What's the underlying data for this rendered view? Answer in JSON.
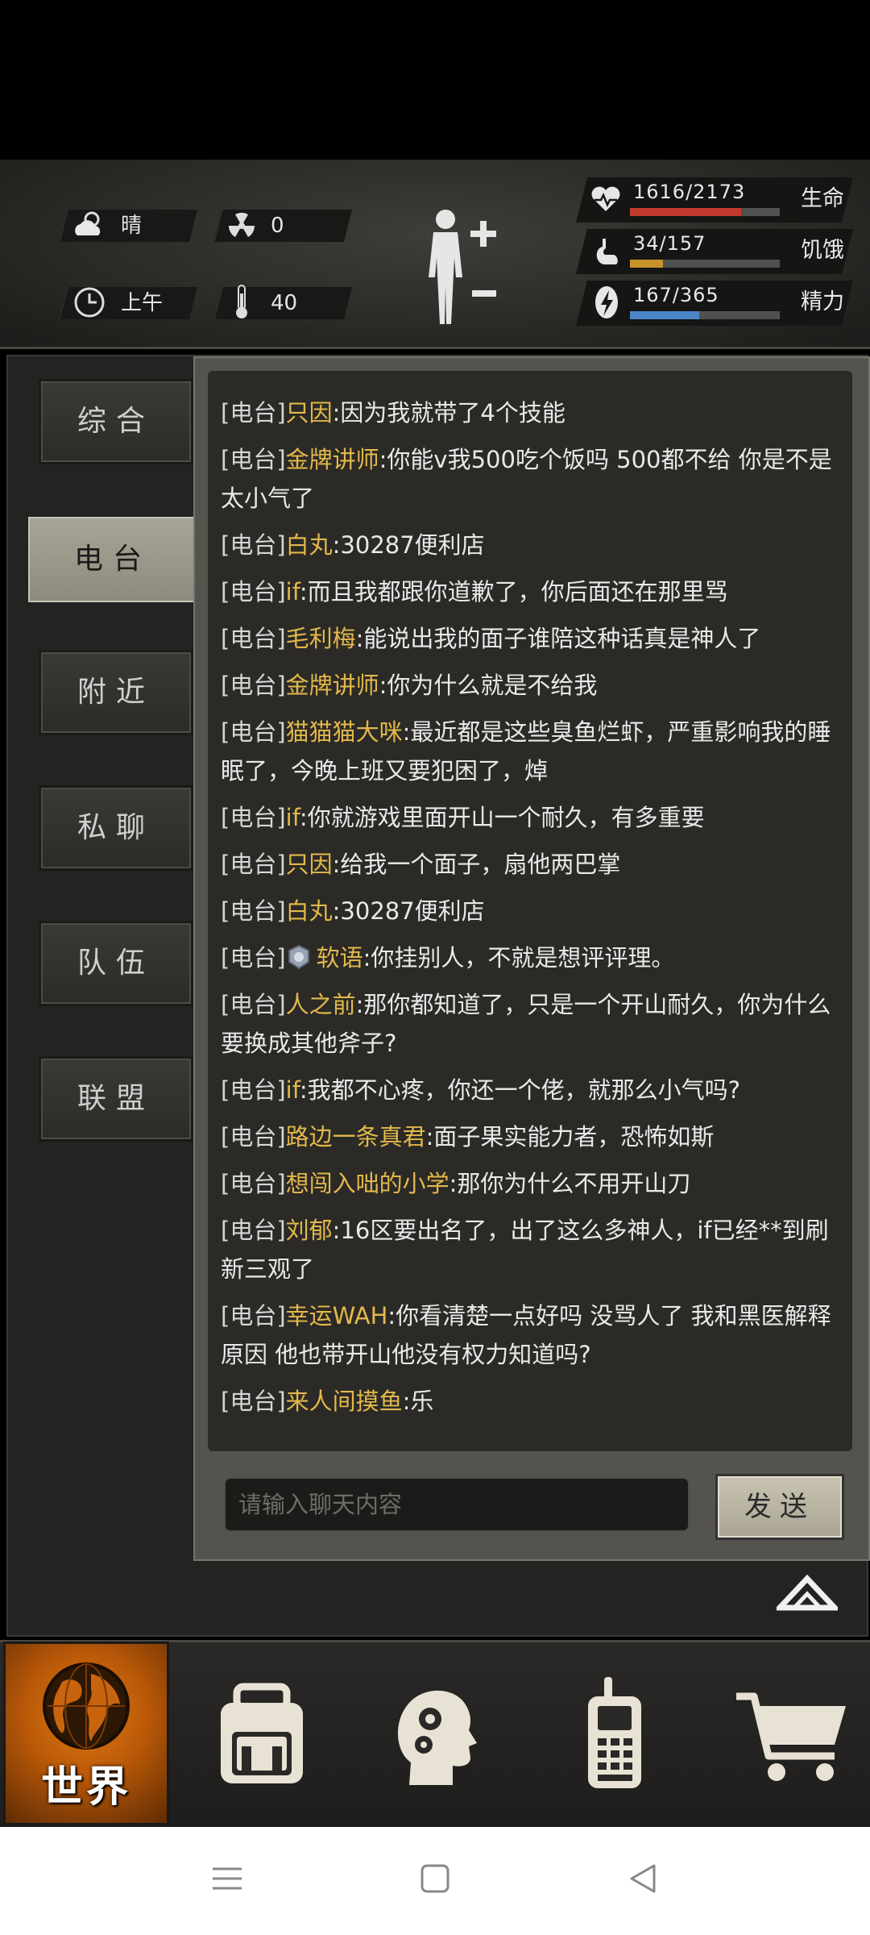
{
  "status": {
    "weather_label": "晴",
    "radiation_value": "0",
    "time_label": "上午",
    "temperature_value": "40"
  },
  "vitals": {
    "health": {
      "text": "1616/2173",
      "label": "生命",
      "fraction": 0.74,
      "color": "#c23a2e"
    },
    "hunger": {
      "text": "34/157",
      "label": "饥饿",
      "fraction": 0.22,
      "color": "#c9912a"
    },
    "energy": {
      "text": "167/365",
      "label": "精力",
      "fraction": 0.46,
      "color": "#4a86c8"
    }
  },
  "tabs": [
    {
      "label": "综合",
      "active": false
    },
    {
      "label": "电台",
      "active": true
    },
    {
      "label": "附近",
      "active": false
    },
    {
      "label": "私聊",
      "active": false
    },
    {
      "label": "队伍",
      "active": false
    },
    {
      "label": "联盟",
      "active": false
    }
  ],
  "messages": [
    {
      "channel": "[电台]",
      "user": "只因",
      "text": ":因为我就带了4个技能"
    },
    {
      "channel": "[电台]",
      "user": "金牌讲师",
      "text": ":你能v我500吃个饭吗 500都不给 你是不是太小气了"
    },
    {
      "channel": "[电台]",
      "user": "白丸",
      "text": ":30287便利店"
    },
    {
      "channel": "[电台]",
      "user": "if",
      "text": ":而且我都跟你道歉了，你后面还在那里骂"
    },
    {
      "channel": "[电台]",
      "user": "毛利梅",
      "text": ":能说出我的面子谁陪这种话真是神人了"
    },
    {
      "channel": "[电台]",
      "user": "金牌讲师",
      "text": ":你为什么就是不给我"
    },
    {
      "channel": "[电台]",
      "user": "猫猫猫大咪",
      "text": ":最近都是这些臭鱼烂虾，严重影响我的睡眠了，今晚上班又要犯困了，焯"
    },
    {
      "channel": "[电台]",
      "user": "if",
      "text": ":你就游戏里面开山一个耐久，有多重要"
    },
    {
      "channel": "[电台]",
      "user": "只因",
      "text": ":给我一个面子，扇他两巴掌"
    },
    {
      "channel": "[电台]",
      "user": "白丸",
      "text": ":30287便利店"
    },
    {
      "channel": "[电台]",
      "user": "软语",
      "text": ":你挂别人，不就是想评评理。",
      "badge": true
    },
    {
      "channel": "[电台]",
      "user": "人之前",
      "text": ":那你都知道了，只是一个开山耐久，你为什么要换成其他斧子?"
    },
    {
      "channel": "[电台]",
      "user": "if",
      "text": ":我都不心疼，你还一个佬，就那么小气吗?"
    },
    {
      "channel": "[电台]",
      "user": "路边一条真君",
      "text": ":面子果实能力者，恐怖如斯"
    },
    {
      "channel": "[电台]",
      "user": "想闯入咄的小学",
      "text": ":那你为什么不用开山刀"
    },
    {
      "channel": "[电台]",
      "user": "刘郁",
      "text": ":16区要出名了，出了这么多神人，if已经**到刷新三观了"
    },
    {
      "channel": "[电台]",
      "user": "幸运WAH",
      "text": ":你看清楚一点好吗 没骂人了 我和黑医解释原因 他也带开山他没有权力知道吗?"
    },
    {
      "channel": "[电台]",
      "user": "来人间摸鱼",
      "text": ":乐"
    }
  ],
  "input": {
    "placeholder": "请输入聊天内容"
  },
  "send_label": "发送",
  "bottom_nav": {
    "world_label": "世界",
    "icons": [
      "globe-icon",
      "backpack-icon",
      "skills-head-icon",
      "radio-icon",
      "shopping-cart-icon"
    ]
  },
  "system_nav": [
    "menu-icon",
    "home-icon",
    "back-icon"
  ]
}
